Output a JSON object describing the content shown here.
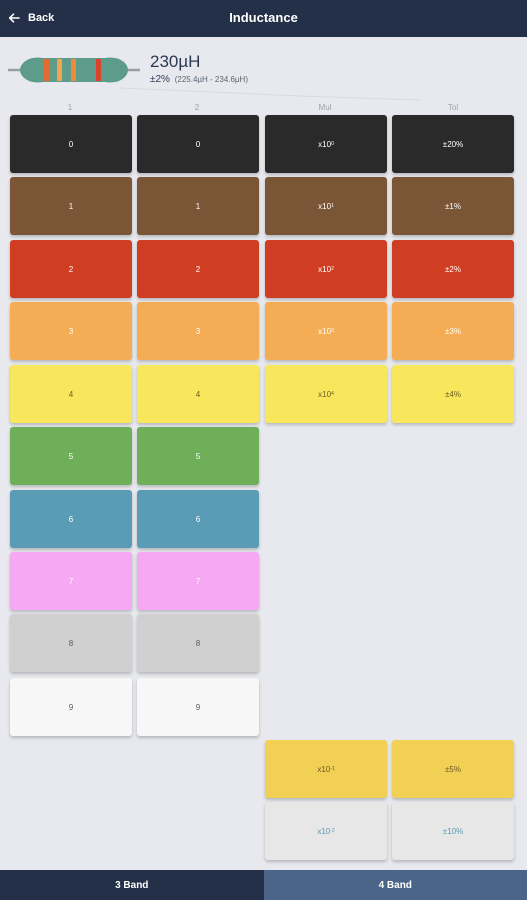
{
  "header": {
    "back_label": "Back",
    "title": "Inductance"
  },
  "summary": {
    "value": "230µH",
    "tolerance": "±2%",
    "range": "(225.4µH - 234.6µH)"
  },
  "columns": [
    "1",
    "2",
    "Mul",
    "Tol"
  ],
  "band_colors": [
    "#e46a2e",
    "#f4a450",
    "#f08a3c",
    "#d9422c"
  ],
  "digits": [
    {
      "label": "0",
      "color": "#2a2a2a",
      "text_color": "#ffffff"
    },
    {
      "label": "1",
      "color": "#7a5637",
      "text_color": "#ffffff"
    },
    {
      "label": "2",
      "color": "#cf3d22",
      "text_color": "#ffffff"
    },
    {
      "label": "3",
      "color": "#f5ad55",
      "text_color": "#ffffff"
    },
    {
      "label": "4",
      "color": "#f8e65c",
      "text_color": "#6b5c24"
    },
    {
      "label": "5",
      "color": "#6faf5a",
      "text_color": "#ffffff"
    },
    {
      "label": "6",
      "color": "#5a9bb5",
      "text_color": "#ffffff"
    },
    {
      "label": "7",
      "color": "#f4a9f2",
      "text_color": "#ffffff"
    },
    {
      "label": "8",
      "color": "#d0d0d0",
      "text_color": "#5a5a5a"
    },
    {
      "label": "9",
      "color": "#f7f7f7",
      "text_color": "#5a5a5a"
    }
  ],
  "multipliers": [
    {
      "base": "x10",
      "exp": "0",
      "color": "#2a2a2a",
      "text_color": "#ffffff"
    },
    {
      "base": "x10",
      "exp": "1",
      "color": "#7a5637",
      "text_color": "#ffffff"
    },
    {
      "base": "x10",
      "exp": "2",
      "color": "#cf3d22",
      "text_color": "#ffffff"
    },
    {
      "base": "x10",
      "exp": "3",
      "color": "#f5ad55",
      "text_color": "#ffffff"
    },
    {
      "base": "x10",
      "exp": "4",
      "color": "#f8e65c",
      "text_color": "#6b5c24"
    },
    {
      "base": "x10",
      "exp": "-1",
      "color": "#f2cf55",
      "text_color": "#6b5c24"
    },
    {
      "base": "x10",
      "exp": "-2",
      "color": "#e7e7e7",
      "text_color": "#5a9bb5"
    }
  ],
  "tolerances": [
    {
      "label": "±20%",
      "color": "#2a2a2a",
      "text_color": "#ffffff"
    },
    {
      "label": "±1%",
      "color": "#7a5637",
      "text_color": "#ffffff"
    },
    {
      "label": "±2%",
      "color": "#cf3d22",
      "text_color": "#ffffff"
    },
    {
      "label": "±3%",
      "color": "#f5ad55",
      "text_color": "#ffffff"
    },
    {
      "label": "±4%",
      "color": "#f8e65c",
      "text_color": "#6b5c24"
    },
    {
      "label": "±5%",
      "color": "#f2cf55",
      "text_color": "#6b5c24"
    },
    {
      "label": "±10%",
      "color": "#e7e7e7",
      "text_color": "#5a9bb5"
    }
  ],
  "tabs": {
    "three_band": "3 Band",
    "four_band": "4 Band"
  }
}
